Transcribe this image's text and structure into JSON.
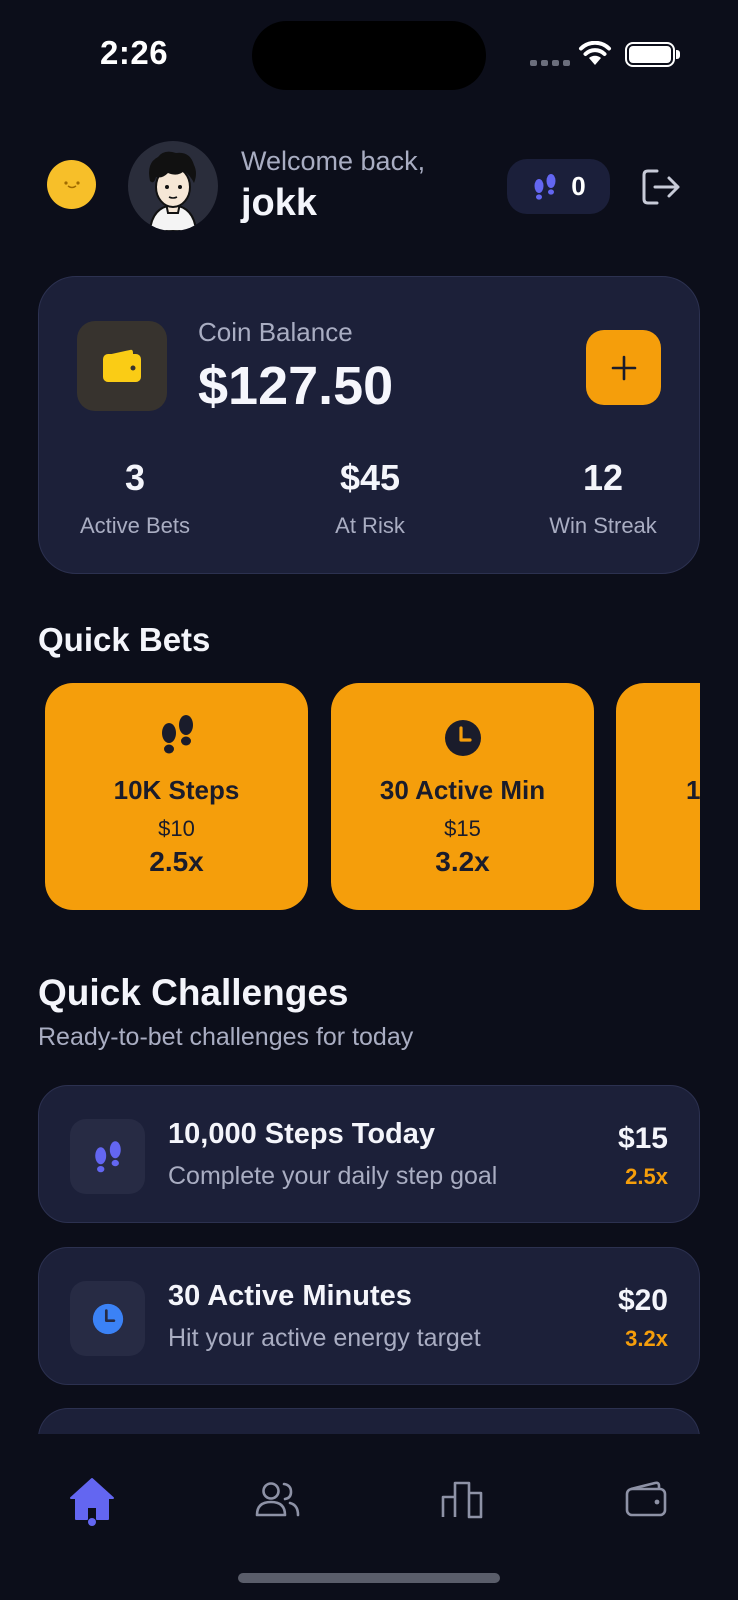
{
  "status_bar": {
    "time": "2:26"
  },
  "header": {
    "welcome_text": "Welcome back,",
    "username": "jokk",
    "steps_count": "0"
  },
  "balance": {
    "label": "Coin Balance",
    "amount": "$127.50",
    "add_label": "+",
    "stats": [
      {
        "value": "3",
        "label": "Active Bets"
      },
      {
        "value": "$45",
        "label": "At Risk"
      },
      {
        "value": "12",
        "label": "Win Streak"
      }
    ]
  },
  "quick_bets": {
    "title": "Quick Bets",
    "items": [
      {
        "icon": "footprints-icon",
        "title": "10K Steps",
        "price": "$10",
        "multiplier": "2.5x"
      },
      {
        "icon": "clock-icon",
        "title": "30 Active Min",
        "price": "$15",
        "multiplier": "3.2x"
      },
      {
        "icon": "",
        "title": "1",
        "price": "",
        "multiplier": ""
      }
    ]
  },
  "quick_challenges": {
    "title": "Quick Challenges",
    "subtitle": "Ready-to-bet challenges for today",
    "items": [
      {
        "icon": "footprints-icon",
        "title": "10,000 Steps Today",
        "description": "Complete your daily step goal",
        "price": "$15",
        "multiplier": "2.5x"
      },
      {
        "icon": "clock-icon",
        "title": "30 Active Minutes",
        "description": "Hit your active energy target",
        "price": "$20",
        "multiplier": "3.2x"
      }
    ]
  },
  "tab_bar": {
    "tabs": [
      {
        "icon": "home-icon",
        "active": true
      },
      {
        "icon": "people-icon",
        "active": false
      },
      {
        "icon": "leaderboard-icon",
        "active": false
      },
      {
        "icon": "wallet-icon",
        "active": false
      }
    ]
  },
  "colors": {
    "background": "#0c0e1a",
    "card": "#1c2039",
    "accent_orange": "#f59e0b",
    "accent_indigo": "#6366f1",
    "clock_blue": "#3b82f6",
    "muted_text": "#a9adc2"
  }
}
